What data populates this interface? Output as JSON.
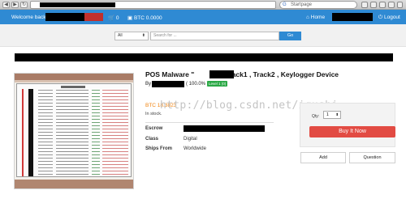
{
  "browser": {
    "search_engine_label": "Startpage",
    "search_engine_glyph": "G"
  },
  "topbar": {
    "welcome": "Welcome back",
    "cart_count": "0",
    "btc_balance": "BTC 0.0000",
    "home": "Home",
    "logout": "Logout",
    "accent_color": "#2f8ad3"
  },
  "search": {
    "category": "All",
    "placeholder": "Search for ...",
    "button": "Go"
  },
  "product": {
    "title_prefix": "POS Malware \"",
    "title_suffix": "\" Track1 , Track2 , Keylogger Device",
    "by_label": "By",
    "rating_pct": "( 100.0% )",
    "level_badge": "Level 1 (0)",
    "price": "BTC 18.3823",
    "stock": "In stock.",
    "escrow_label": "Escrow",
    "class_label": "Class",
    "class_value": "Digital",
    "ships_from_label": "Ships From",
    "ships_from_value": "Worldwide"
  },
  "purchase": {
    "qty_label": "Qty:",
    "qty_value": "1",
    "buy_button": "Buy It Now",
    "buy_color": "#e24b43",
    "add_button": "Add",
    "question_button": "Question"
  },
  "watermark": "http://blog.csdn.net/iqushi"
}
